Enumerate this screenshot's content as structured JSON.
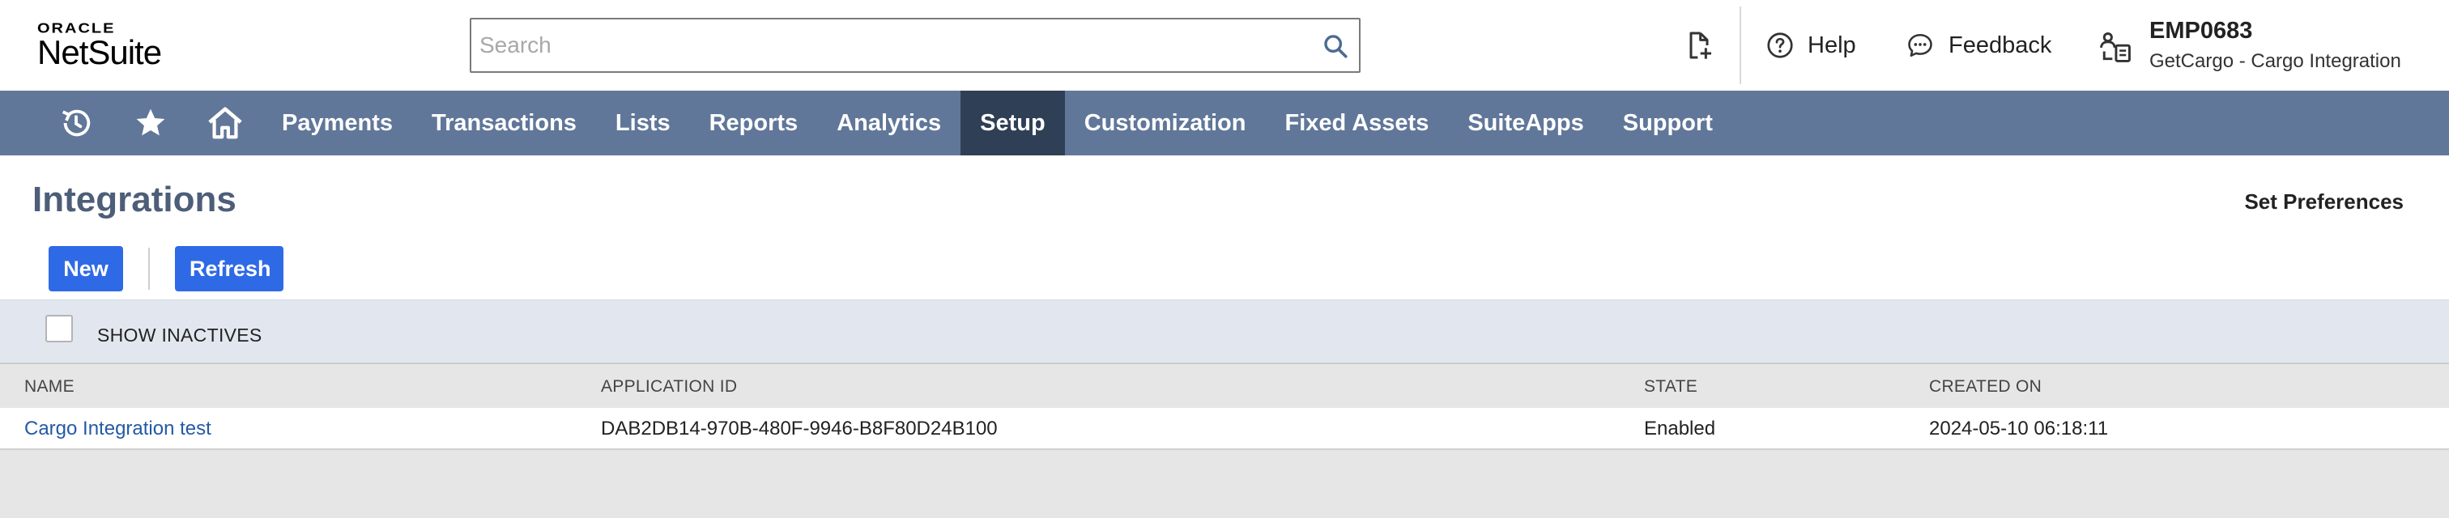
{
  "header": {
    "logo_top": "ORACLE",
    "logo_bottom": "NetSuite",
    "search": {
      "placeholder": "Search",
      "value": ""
    },
    "icons": {
      "new_doc": "new-document-icon",
      "help": "help-circle-icon",
      "feedback": "chat-bubble-icon",
      "user": "user-roles-icon",
      "search": "search-icon"
    },
    "help_label": "Help",
    "feedback_label": "Feedback",
    "user": {
      "id": "EMP0683",
      "account": "GetCargo - Cargo Integration"
    }
  },
  "nav": {
    "icons": [
      "recent-history-icon",
      "star-icon",
      "home-icon"
    ],
    "items": [
      {
        "label": "Payments",
        "active": false
      },
      {
        "label": "Transactions",
        "active": false
      },
      {
        "label": "Lists",
        "active": false
      },
      {
        "label": "Reports",
        "active": false
      },
      {
        "label": "Analytics",
        "active": false
      },
      {
        "label": "Setup",
        "active": true
      },
      {
        "label": "Customization",
        "active": false
      },
      {
        "label": "Fixed Assets",
        "active": false
      },
      {
        "label": "SuiteApps",
        "active": false
      },
      {
        "label": "Support",
        "active": false
      }
    ]
  },
  "page": {
    "title": "Integrations",
    "set_preferences": "Set Preferences",
    "buttons": {
      "new": "New",
      "refresh": "Refresh"
    },
    "filter": {
      "show_inactives_label": "SHOW INACTIVES",
      "show_inactives_checked": false
    }
  },
  "table": {
    "columns": [
      "NAME",
      "APPLICATION ID",
      "STATE",
      "CREATED ON"
    ],
    "rows": [
      {
        "name": "Cargo Integration test",
        "application_id": "DAB2DB14-970B-480F-9946-B8F80D24B100",
        "state": "Enabled",
        "created_on": "2024-05-10 06:18:11"
      }
    ]
  },
  "colors": {
    "nav_bg": "#607799",
    "nav_active": "#2f3f55",
    "button": "#2f6ae6",
    "title": "#4d5e78",
    "link": "#235aa6"
  }
}
